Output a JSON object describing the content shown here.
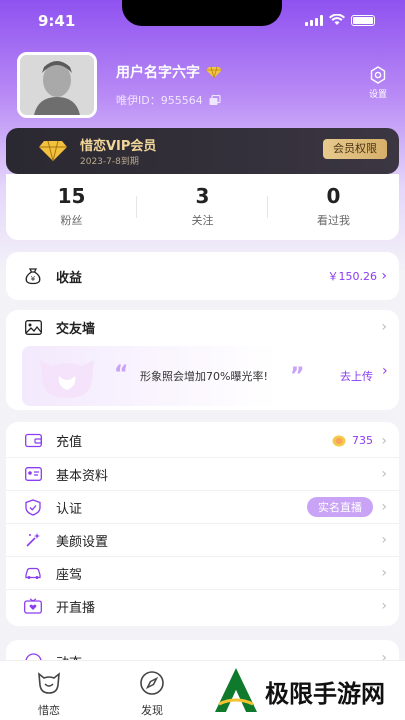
{
  "status_bar": {
    "time": "9:41"
  },
  "profile": {
    "username": "用户名字六字",
    "id_label": "唯伊ID：",
    "id_value": "955564",
    "settings_label": "设置"
  },
  "vip": {
    "title": "惜恋VIP会员",
    "expiry": "2023-7-8到期",
    "button": "会员权限"
  },
  "stats": [
    {
      "value": "15",
      "label": "粉丝"
    },
    {
      "value": "3",
      "label": "关注"
    },
    {
      "value": "0",
      "label": "看过我"
    }
  ],
  "earnings": {
    "label": "收益",
    "amount": "￥150.26"
  },
  "photo_wall": {
    "label": "交友墙",
    "tip": "形象照会增加70%曝光率!",
    "upload": "去上传"
  },
  "menu": {
    "recharge": {
      "label": "充值",
      "coins": "735"
    },
    "profile": {
      "label": "基本资料"
    },
    "verify": {
      "label": "认证",
      "badge": "实名直播"
    },
    "beauty": {
      "label": "美颜设置"
    },
    "car": {
      "label": "座驾"
    },
    "live": {
      "label": "开直播"
    }
  },
  "partial_row": {
    "label": "动态"
  },
  "tabbar": [
    {
      "label": "惜恋"
    },
    {
      "label": "发现"
    }
  ],
  "watermark": {
    "text": "极限手游网"
  },
  "colors": {
    "accent": "#8b3df0",
    "header_gradient_top": "#8f52f0",
    "vip_gold": "#f2d79a"
  }
}
